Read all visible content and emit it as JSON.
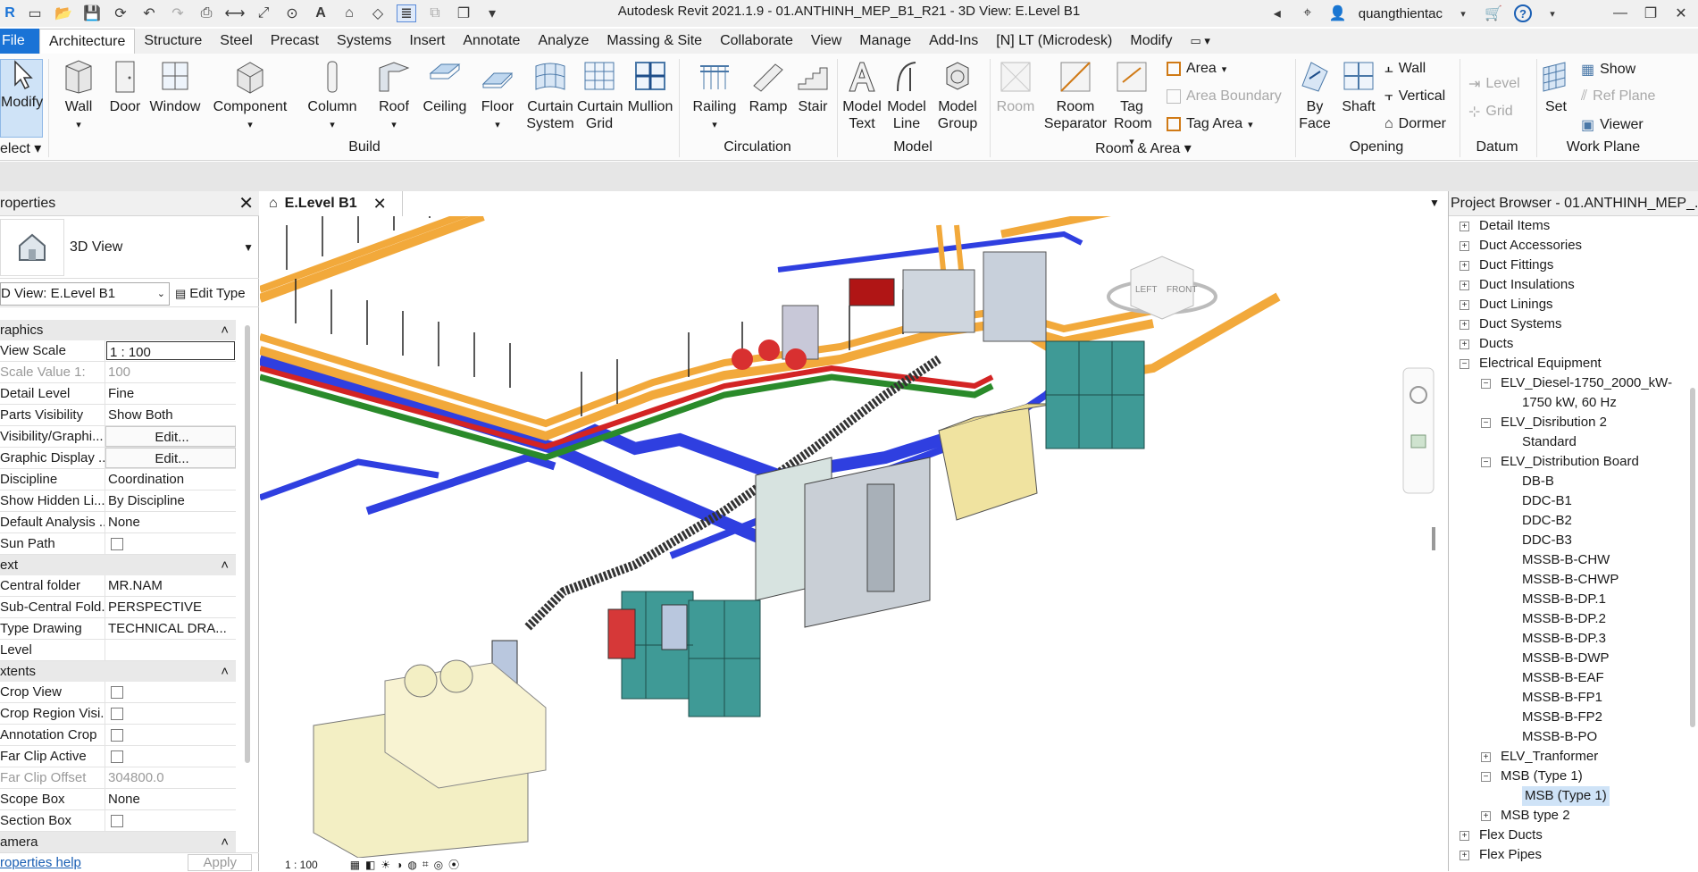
{
  "titlebar": {
    "title": "Autodesk Revit 2021.1.9 - 01.ANTHINH_MEP_B1_R21 - 3D View: E.Level B1",
    "user": "quangthientac",
    "qa_icons": [
      "revit-logo-icon",
      "new-icon",
      "open-icon",
      "save-icon",
      "sync-icon",
      "undo-icon",
      "redo-icon",
      "print-icon",
      "measure-icon",
      "dimension-icon",
      "tag-icon",
      "text-icon",
      "3d-view-icon",
      "section-icon",
      "thin-lines-icon",
      "close-hidden-icon",
      "switch-windows-icon",
      "customize-icon"
    ]
  },
  "tabs": [
    "File",
    "Architecture",
    "Structure",
    "Steel",
    "Precast",
    "Systems",
    "Insert",
    "Annotate",
    "Analyze",
    "Massing & Site",
    "Collaborate",
    "View",
    "Manage",
    "Add-Ins",
    "[N] LT (Microdesk)",
    "Modify"
  ],
  "ribbon": {
    "select_label": "Modify",
    "select_group": "elect",
    "build": {
      "tools": [
        "Wall",
        "Door",
        "Window",
        "Component",
        "Column",
        "Roof",
        "Ceiling",
        "Floor",
        "Curtain System",
        "Curtain Grid",
        "Mullion"
      ],
      "group": "Build"
    },
    "circulation": {
      "tools": [
        "Railing",
        "Ramp",
        "Stair"
      ],
      "group": "Circulation"
    },
    "model": {
      "tools": [
        "Model Text",
        "Model Line",
        "Model Group"
      ],
      "group": "Model"
    },
    "room_area": {
      "tools": [
        "Room",
        "Room Separator",
        "Tag Room"
      ],
      "small": [
        "Area",
        "Area  Boundary",
        "Tag  Area"
      ],
      "group": "Room & Area"
    },
    "opening": {
      "tools": [
        "By Face",
        "Shaft"
      ],
      "small": [
        "Wall",
        "Vertical",
        "Dormer"
      ],
      "group": "Opening"
    },
    "datum": {
      "small": [
        "Level",
        "Grid"
      ],
      "group": "Datum"
    },
    "work_plane": {
      "tools": [
        "Set"
      ],
      "small": [
        "Show",
        "Ref  Plane",
        "Viewer"
      ],
      "group": "Work Plane"
    }
  },
  "properties": {
    "title": "roperties",
    "type_name": "3D View",
    "instance_selector": "D View: E.Level B1",
    "edit_type": "Edit Type",
    "sections": {
      "graphics": "raphics",
      "text": "ext",
      "extents": "xtents",
      "camera": "amera"
    },
    "rows": [
      {
        "k": "View Scale",
        "v": "1 : 100"
      },
      {
        "k": "Scale Value    1:",
        "v": "100"
      },
      {
        "k": "Detail Level",
        "v": "Fine"
      },
      {
        "k": "Parts Visibility",
        "v": "Show Both"
      },
      {
        "k": "Visibility/Graphi...",
        "v": "Edit..."
      },
      {
        "k": "Graphic Display ...",
        "v": "Edit..."
      },
      {
        "k": "Discipline",
        "v": "Coordination"
      },
      {
        "k": "Show Hidden Li...",
        "v": "By Discipline"
      },
      {
        "k": "Default Analysis ...",
        "v": "None"
      },
      {
        "k": "Sun Path",
        "v": ""
      },
      {
        "k": "Central folder",
        "v": "MR.NAM"
      },
      {
        "k": "Sub-Central Fold...",
        "v": "PERSPECTIVE"
      },
      {
        "k": "Type Drawing",
        "v": "TECHNICAL DRA..."
      },
      {
        "k": "Level",
        "v": ""
      },
      {
        "k": "Crop View",
        "v": ""
      },
      {
        "k": "Crop Region Visi...",
        "v": ""
      },
      {
        "k": "Annotation Crop",
        "v": ""
      },
      {
        "k": "Far Clip Active",
        "v": ""
      },
      {
        "k": "Far Clip Offset",
        "v": "304800.0"
      },
      {
        "k": "Scope Box",
        "v": "None"
      },
      {
        "k": "Section Box",
        "v": ""
      }
    ],
    "help_link": "roperties help",
    "apply": "Apply"
  },
  "view": {
    "tab_label": "E.Level B1",
    "scale": "1 : 100",
    "viewcube_left": "LEFT",
    "viewcube_front": "FRONT"
  },
  "browser": {
    "title": "Project Browser - 01.ANTHINH_MEP_...",
    "nodes": [
      {
        "label": "Detail Items",
        "lvl": 0,
        "exp": "+"
      },
      {
        "label": "Duct Accessories",
        "lvl": 0,
        "exp": "+"
      },
      {
        "label": "Duct Fittings",
        "lvl": 0,
        "exp": "+"
      },
      {
        "label": "Duct Insulations",
        "lvl": 0,
        "exp": "+"
      },
      {
        "label": "Duct Linings",
        "lvl": 0,
        "exp": "+"
      },
      {
        "label": "Duct Systems",
        "lvl": 0,
        "exp": "+"
      },
      {
        "label": "Ducts",
        "lvl": 0,
        "exp": "+"
      },
      {
        "label": "Electrical Equipment",
        "lvl": 0,
        "exp": "-"
      },
      {
        "label": "ELV_Diesel-1750_2000_kW-",
        "lvl": 1,
        "exp": "-"
      },
      {
        "label": "1750 kW, 60 Hz",
        "lvl": 2,
        "exp": ""
      },
      {
        "label": "ELV_Disribution 2",
        "lvl": 1,
        "exp": "-"
      },
      {
        "label": "Standard",
        "lvl": 2,
        "exp": ""
      },
      {
        "label": "ELV_Distribution Board",
        "lvl": 1,
        "exp": "-"
      },
      {
        "label": "DB-B",
        "lvl": 2,
        "exp": ""
      },
      {
        "label": "DDC-B1",
        "lvl": 2,
        "exp": ""
      },
      {
        "label": "DDC-B2",
        "lvl": 2,
        "exp": ""
      },
      {
        "label": "DDC-B3",
        "lvl": 2,
        "exp": ""
      },
      {
        "label": "MSSB-B-CHW",
        "lvl": 2,
        "exp": ""
      },
      {
        "label": "MSSB-B-CHWP",
        "lvl": 2,
        "exp": ""
      },
      {
        "label": "MSSB-B-DP.1",
        "lvl": 2,
        "exp": ""
      },
      {
        "label": "MSSB-B-DP.2",
        "lvl": 2,
        "exp": ""
      },
      {
        "label": "MSSB-B-DP.3",
        "lvl": 2,
        "exp": ""
      },
      {
        "label": "MSSB-B-DWP",
        "lvl": 2,
        "exp": ""
      },
      {
        "label": "MSSB-B-EAF",
        "lvl": 2,
        "exp": ""
      },
      {
        "label": "MSSB-B-FP1",
        "lvl": 2,
        "exp": ""
      },
      {
        "label": "MSSB-B-FP2",
        "lvl": 2,
        "exp": ""
      },
      {
        "label": "MSSB-B-PO",
        "lvl": 2,
        "exp": ""
      },
      {
        "label": "ELV_Tranformer",
        "lvl": 1,
        "exp": "+"
      },
      {
        "label": "MSB (Type 1)",
        "lvl": 1,
        "exp": "-"
      },
      {
        "label": "MSB (Type 1)",
        "lvl": 2,
        "exp": "",
        "sel": true
      },
      {
        "label": "MSB type 2",
        "lvl": 1,
        "exp": "+"
      },
      {
        "label": "Flex Ducts",
        "lvl": 0,
        "exp": "+"
      },
      {
        "label": "Flex Pipes",
        "lvl": 0,
        "exp": "+"
      }
    ]
  },
  "colors": {
    "file_tab": "#1a73d6",
    "cable_tray": "#f2a93b",
    "pipe_blue": "#2f3fe0",
    "green": "#2a8a2a",
    "red": "#d32424",
    "panel_teal": "#3f9a96",
    "generator": "#f3efc4"
  }
}
